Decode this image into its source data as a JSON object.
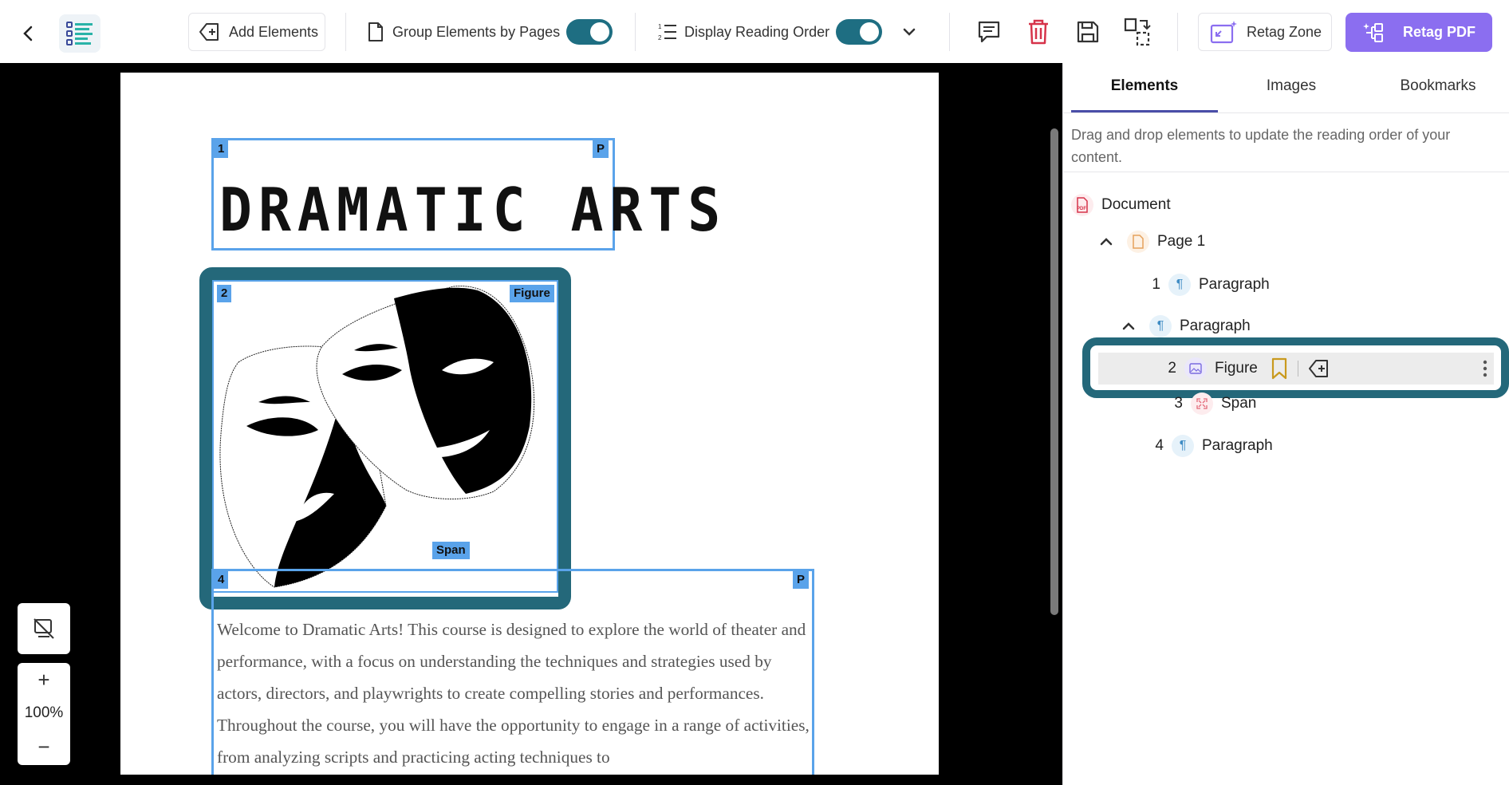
{
  "toolbar": {
    "add_elements": "Add Elements",
    "group_by_pages": "Group Elements by Pages",
    "display_reading_order": "Display Reading Order",
    "retag_zone": "Retag Zone",
    "retag_pdf": "Retag PDF",
    "group_by_pages_on": true,
    "display_reading_order_on": true,
    "icons": [
      "back-icon",
      "element-list-icon",
      "tag-plus-icon",
      "page-icon",
      "reading-order-icon",
      "chevron-down-icon",
      "comment-icon",
      "trash-icon",
      "save-icon",
      "swap-pages-icon",
      "retag-zone-icon",
      "retag-pdf-icon"
    ]
  },
  "document": {
    "title": "DRAMATIC ARTS",
    "body": "Welcome to Dramatic Arts! This course is designed to explore the world of theater and performance, with a focus on understanding the techniques and strategies used by actors, directors, and playwrights to create compelling stories and performances. Throughout the course, you will have the opportunity to engage in a range of activities, from analyzing scripts and practicing acting techniques to",
    "tags": [
      {
        "order": "1",
        "type": "P"
      },
      {
        "order": "2",
        "type": "Figure"
      },
      {
        "order": "",
        "type": "Span"
      },
      {
        "order": "4",
        "type": "P"
      }
    ]
  },
  "zoom": {
    "level": "100%",
    "plus": "+",
    "minus": "−"
  },
  "sidebar": {
    "tabs": [
      "Elements",
      "Images",
      "Bookmarks"
    ],
    "active_tab": "Elements",
    "hint": "Drag and drop elements to update the reading order of your content.",
    "tree": {
      "root": "Document",
      "page": "Page 1",
      "items": [
        {
          "num": "1",
          "label": "Paragraph"
        },
        {
          "num": "",
          "label": "Paragraph"
        },
        {
          "num": "2",
          "label": "Figure"
        },
        {
          "num": "3",
          "label": "Span"
        },
        {
          "num": "4",
          "label": "Paragraph"
        }
      ]
    }
  },
  "colors": {
    "accent": "#1e6e82",
    "tag_blue": "#5aa3ea",
    "retag_purple": "#8b6ef0",
    "highlight": "#24687a",
    "danger": "#d6334a"
  }
}
